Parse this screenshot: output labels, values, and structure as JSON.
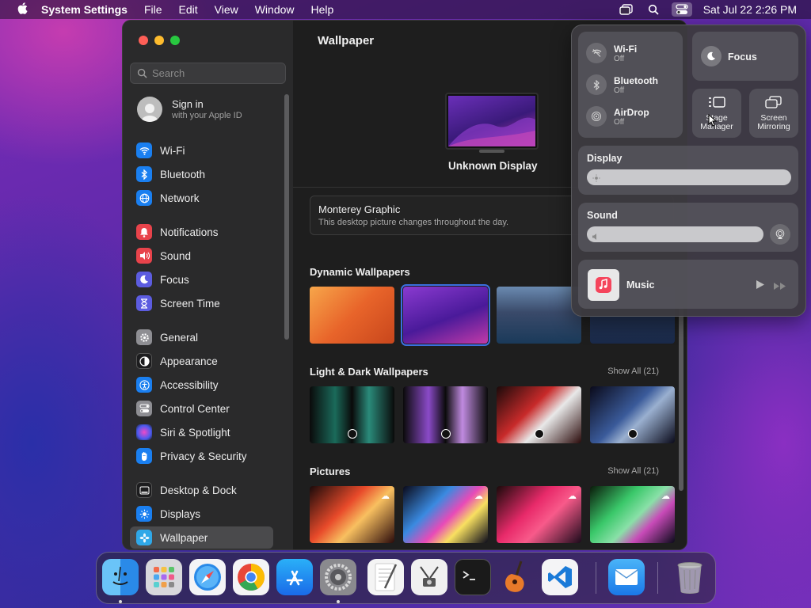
{
  "menubar": {
    "app_name": "System Settings",
    "menus": [
      "File",
      "Edit",
      "View",
      "Window",
      "Help"
    ],
    "clock": "Sat Jul 22  2:26 PM"
  },
  "sidebar": {
    "search_placeholder": "Search",
    "account": {
      "title": "Sign in",
      "subtitle": "with your Apple ID"
    },
    "items": [
      {
        "label": "Wi-Fi",
        "icon": "wifi-icon",
        "color": "#1a7ff0"
      },
      {
        "label": "Bluetooth",
        "icon": "bluetooth-icon",
        "color": "#1a7ff0"
      },
      {
        "label": "Network",
        "icon": "globe-icon",
        "color": "#1a7ff0"
      },
      {
        "label": "Notifications",
        "icon": "bell-icon",
        "color": "#e8434b"
      },
      {
        "label": "Sound",
        "icon": "speaker-icon",
        "color": "#e8434b"
      },
      {
        "label": "Focus",
        "icon": "moon-icon",
        "color": "#5c5ce0"
      },
      {
        "label": "Screen Time",
        "icon": "hourglass-icon",
        "color": "#5c5ce0"
      },
      {
        "label": "General",
        "icon": "gear-icon",
        "color": "#8e8e93"
      },
      {
        "label": "Appearance",
        "icon": "appearance-icon",
        "color": "#1c1c1e"
      },
      {
        "label": "Accessibility",
        "icon": "accessibility-icon",
        "color": "#1a7ff0"
      },
      {
        "label": "Control Center",
        "icon": "toggles-icon",
        "color": "#8e8e93"
      },
      {
        "label": "Siri & Spotlight",
        "icon": "siri-icon",
        "color": "#b04ad8"
      },
      {
        "label": "Privacy & Security",
        "icon": "hand-icon",
        "color": "#1a7ff0"
      },
      {
        "label": "Desktop & Dock",
        "icon": "dock-icon",
        "color": "#1c1c1e"
      },
      {
        "label": "Displays",
        "icon": "sun-icon",
        "color": "#1a7ff0"
      },
      {
        "label": "Wallpaper",
        "icon": "flower-icon",
        "color": "#2fa8e8"
      }
    ],
    "selected": "Wallpaper"
  },
  "main": {
    "title": "Wallpaper",
    "display_name": "Unknown Display",
    "current_wallpaper": {
      "title": "Monterey Graphic",
      "subtitle": "This desktop picture changes throughout the day."
    },
    "sections": [
      {
        "title": "Dynamic Wallpapers",
        "show_all": ""
      },
      {
        "title": "Light & Dark Wallpapers",
        "show_all": "Show All (21)"
      },
      {
        "title": "Pictures",
        "show_all": "Show All (21)"
      }
    ]
  },
  "control_center": {
    "wifi": {
      "title": "Wi-Fi",
      "status": "Off"
    },
    "bluetooth": {
      "title": "Bluetooth",
      "status": "Off"
    },
    "airdrop": {
      "title": "AirDrop",
      "status": "Off"
    },
    "focus": "Focus",
    "stage_manager": "Stage Manager",
    "screen_mirroring": "Screen Mirroring",
    "display": {
      "label": "Display",
      "level": 0
    },
    "sound": {
      "label": "Sound",
      "level": 0
    },
    "music": "Music"
  },
  "dock": {
    "apps": [
      "Finder",
      "Launchpad",
      "Safari",
      "Chrome",
      "App Store",
      "System Settings",
      "TextEdit",
      "Screenshot",
      "Terminal",
      "GarageBand",
      "Visual Studio Code",
      "Mail",
      "Trash"
    ]
  }
}
